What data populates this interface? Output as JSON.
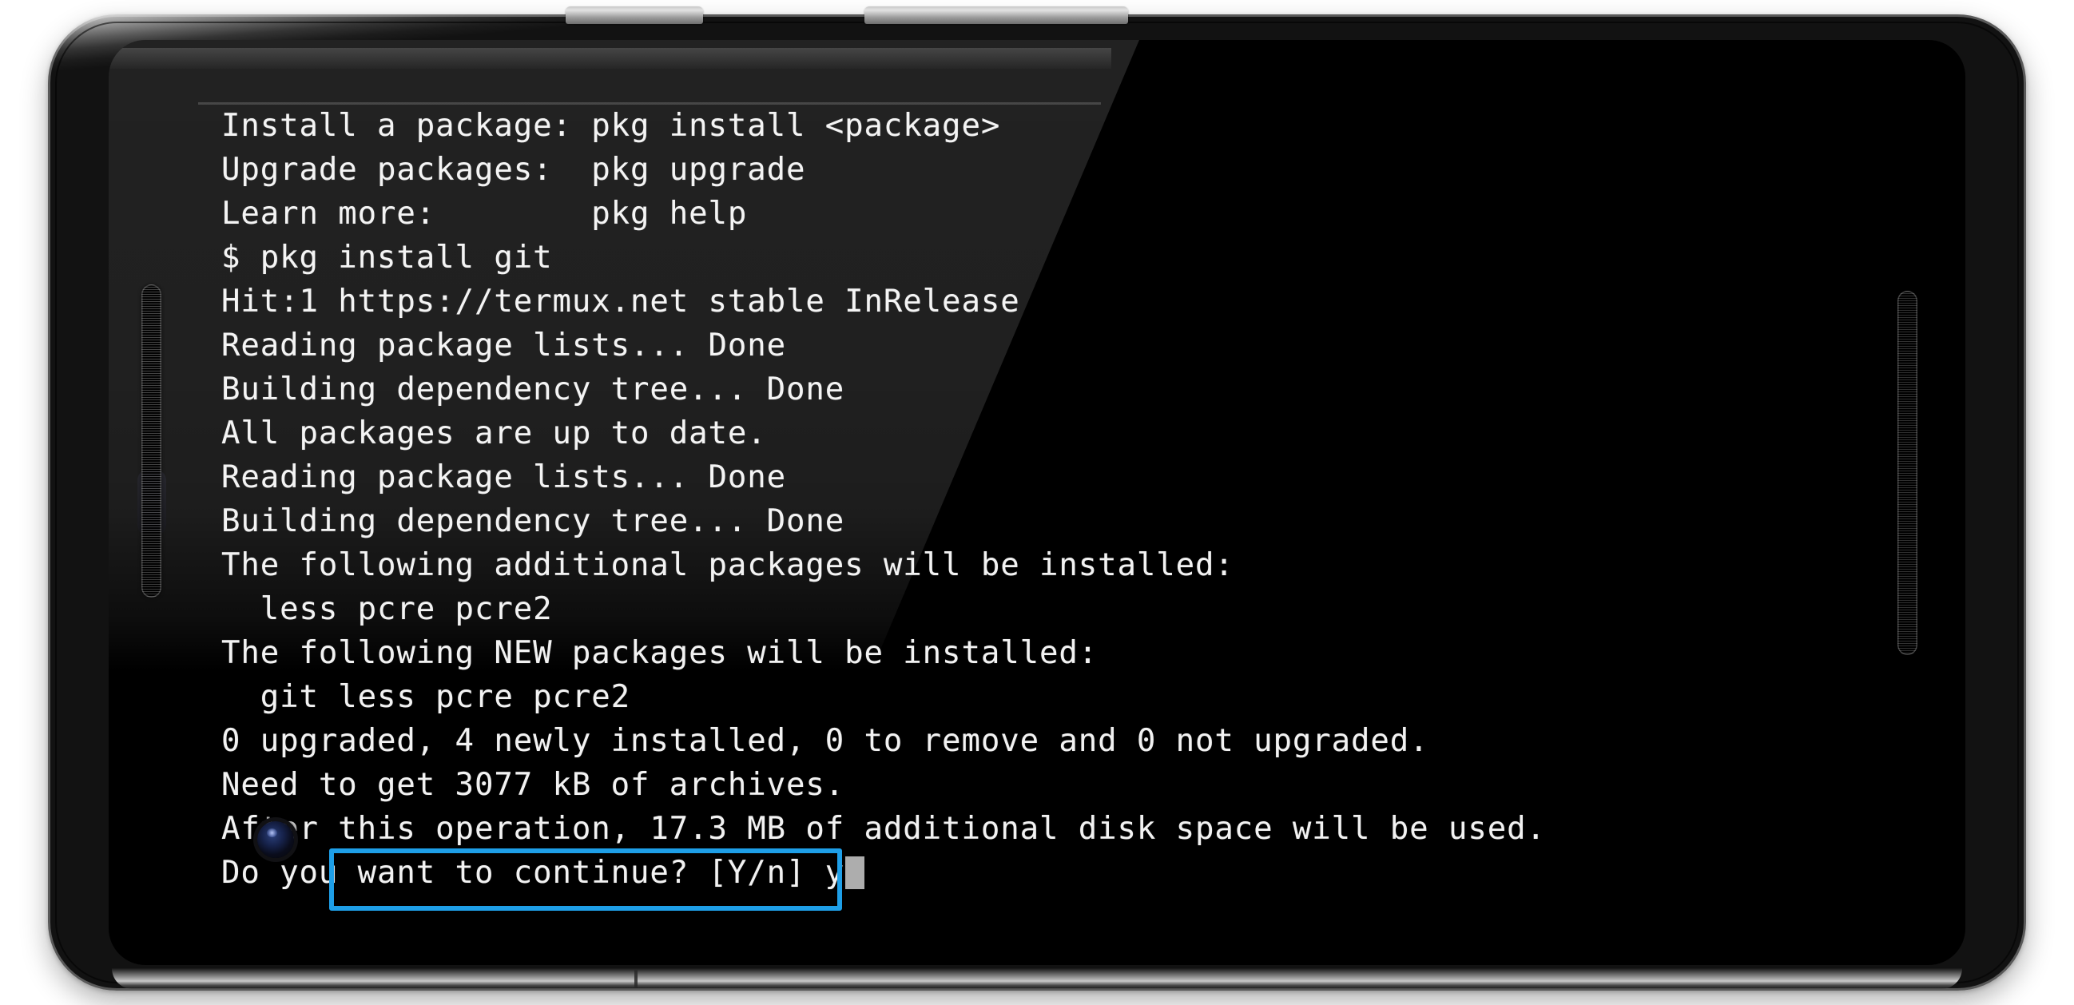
{
  "device": {
    "name": "android-phone-landscape",
    "frame_color": "#1c1c1c",
    "bezel_highlight": "#d9d9d9",
    "hardware": {
      "volume_rocker_label": "volume-rocker",
      "power_button_label": "power-button",
      "front_camera_label": "front-camera",
      "left_speaker_label": "left-speaker-grille",
      "right_speaker_label": "right-speaker-grille",
      "proximity_sensor_label": "proximity-sensor"
    }
  },
  "terminal": {
    "app": "Termux",
    "background": "#000000",
    "foreground": "#f2f2f2",
    "cursor_color": "#adadad",
    "highlight_color": "#1e9fe8",
    "lines": [
      "Install a package: pkg install <package>",
      "Upgrade packages:  pkg upgrade",
      "Learn more:        pkg help",
      "$ pkg install git",
      "Hit:1 https://termux.net stable InRelease",
      "Reading package lists... Done",
      "Building dependency tree... Done",
      "All packages are up to date.",
      "Reading package lists... Done",
      "Building dependency tree... Done",
      "The following additional packages will be installed:",
      "  less pcre pcre2",
      "The following NEW packages will be installed:",
      "  git less pcre pcre2",
      "0 upgraded, 4 newly installed, 0 to remove and 0 not upgraded.",
      "Need to get 3077 kB of archives.",
      "After this operation, 17.3 MB of additional disk space will be used."
    ],
    "prompt": {
      "text": "Do you want to continue? [Y/n] ",
      "typed_answer": "y",
      "options": [
        "Y",
        "n"
      ],
      "highlighted": true
    },
    "session": {
      "install_hint": "Install a package: pkg install <package>",
      "upgrade_hint": "Upgrade packages:  pkg upgrade",
      "help_hint": "Learn more:        pkg help",
      "command": "$ pkg install git",
      "repository": "https://termux.net",
      "repository_suite": "stable InRelease",
      "hit_number": "Hit:1",
      "additional_packages": [
        "less",
        "pcre",
        "pcre2"
      ],
      "new_packages": [
        "git",
        "less",
        "pcre",
        "pcre2"
      ],
      "upgraded_count": "0",
      "newly_installed_count": "4",
      "to_remove_count": "0",
      "not_upgraded_count": "0",
      "download_size": "3077 kB",
      "disk_space": "17.3 MB"
    }
  }
}
